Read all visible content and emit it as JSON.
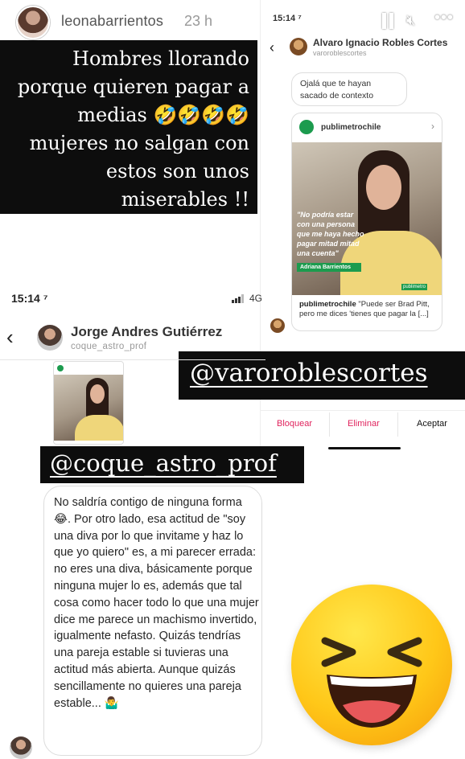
{
  "story": {
    "username": "leonabarrientos",
    "time": "23 h",
    "quote": "Hombres llorando porque quieren pagar a medias 🤣🤣🤣🤣 mujeres no salgan con estos son unos miserables !!"
  },
  "dm_request": {
    "status_time": "15:14 ⁷",
    "contact_name": "Alvaro Ignacio Robles Cortes",
    "contact_handle": "varoroblescortes",
    "message": "Ojalá que te hayan sacado de contexto",
    "shared_post": {
      "account": "publimetrochile",
      "image_caption": "\"No podría estar con una persona que me haya hecho pagar mitad mitad una cuenta\"",
      "image_name": "Adriana Barrientos",
      "image_brand": "publimetro",
      "caption_user": "publimetrochile",
      "caption_text": "\"Puede ser Brad Pitt, pero me dices 'tienes que pagar la [...]"
    },
    "actions": {
      "block": "Bloquear",
      "delete": "Eliminar",
      "accept": "Aceptar"
    }
  },
  "tags": {
    "varo": "@varoroblescortes",
    "coque": "@coque_astro_prof"
  },
  "jorge_chat": {
    "status_time": "15:14 ⁷",
    "network": "4G",
    "contact_name": "Jorge Andres Gutiérrez",
    "contact_handle": "coque_astro_prof",
    "message": "No saldría contigo de ninguna forma 😂. Por otro lado, esa actitud de \"soy una diva por lo que invitame y haz lo que yo quiero\" es, a mi parecer errada: no eres una diva, básicamente porque ninguna mujer lo es, además que tal cosa como hacer todo lo que una mujer dice me parece un machismo invertido, igualmente nefasto. Quizás tendrías una pareja estable si tuvieras una actitud más abierta. Aunque quizás sencillamente no quieres una pareja estable... 🤷‍♂️"
  },
  "sticker": "laughing-face-icon",
  "colors": {
    "tag_background": "#0d0d0d",
    "destructive_action": "#e0245e",
    "brand_green": "#1c9b4e",
    "emoji_yellow": "#ffc718"
  }
}
